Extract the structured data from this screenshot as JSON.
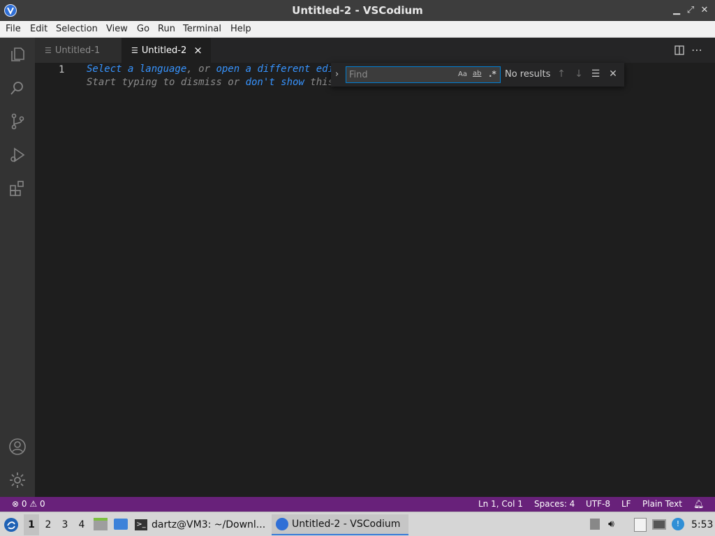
{
  "window": {
    "title": "Untitled-2 - VSCodium"
  },
  "menu": [
    "File",
    "Edit",
    "Selection",
    "View",
    "Go",
    "Run",
    "Terminal",
    "Help"
  ],
  "tabs": [
    {
      "label": "Untitled-1",
      "active": false
    },
    {
      "label": "Untitled-2",
      "active": true,
      "close": "×"
    }
  ],
  "editor": {
    "line_number": "1",
    "hint1": {
      "link1": "Select a language",
      "sep": ", or ",
      "link2": "open a different edi"
    },
    "hint2": {
      "pre": "Start typing to dismiss or ",
      "link": "don't show",
      "post": " this"
    }
  },
  "find": {
    "placeholder": "Find",
    "match_case": "Aa",
    "whole_word": "ab",
    "regex": ".*",
    "result": "No results"
  },
  "status": {
    "errors": "0",
    "warnings": "0",
    "position": "Ln 1, Col 1",
    "spaces": "Spaces: 4",
    "encoding": "UTF-8",
    "eol": "LF",
    "language": "Plain Text"
  },
  "taskbar": {
    "workspaces": [
      "1",
      "2",
      "3",
      "4"
    ],
    "terminal_task": "dartz@VM3: ~/Downl...",
    "editor_task": "Untitled-2 - VSCodium",
    "clock": "5:53"
  },
  "colors": {
    "statusbar": "#68217a",
    "accent": "#007fd4",
    "link": "#3794ff"
  }
}
